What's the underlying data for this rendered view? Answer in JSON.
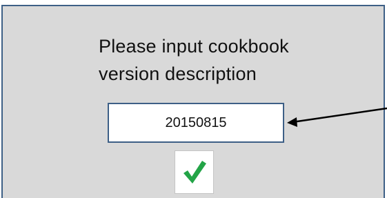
{
  "dialog": {
    "prompt_line1": "Please input cookbook",
    "prompt_line2": "version description"
  },
  "version_input": {
    "value": "20150815"
  },
  "confirm_button": {
    "icon": "checkmark-icon"
  },
  "colors": {
    "dialog_background": "#d9d9d9",
    "border": "#3d5f86",
    "checkmark": "#23a447",
    "arrow": "#000000"
  }
}
